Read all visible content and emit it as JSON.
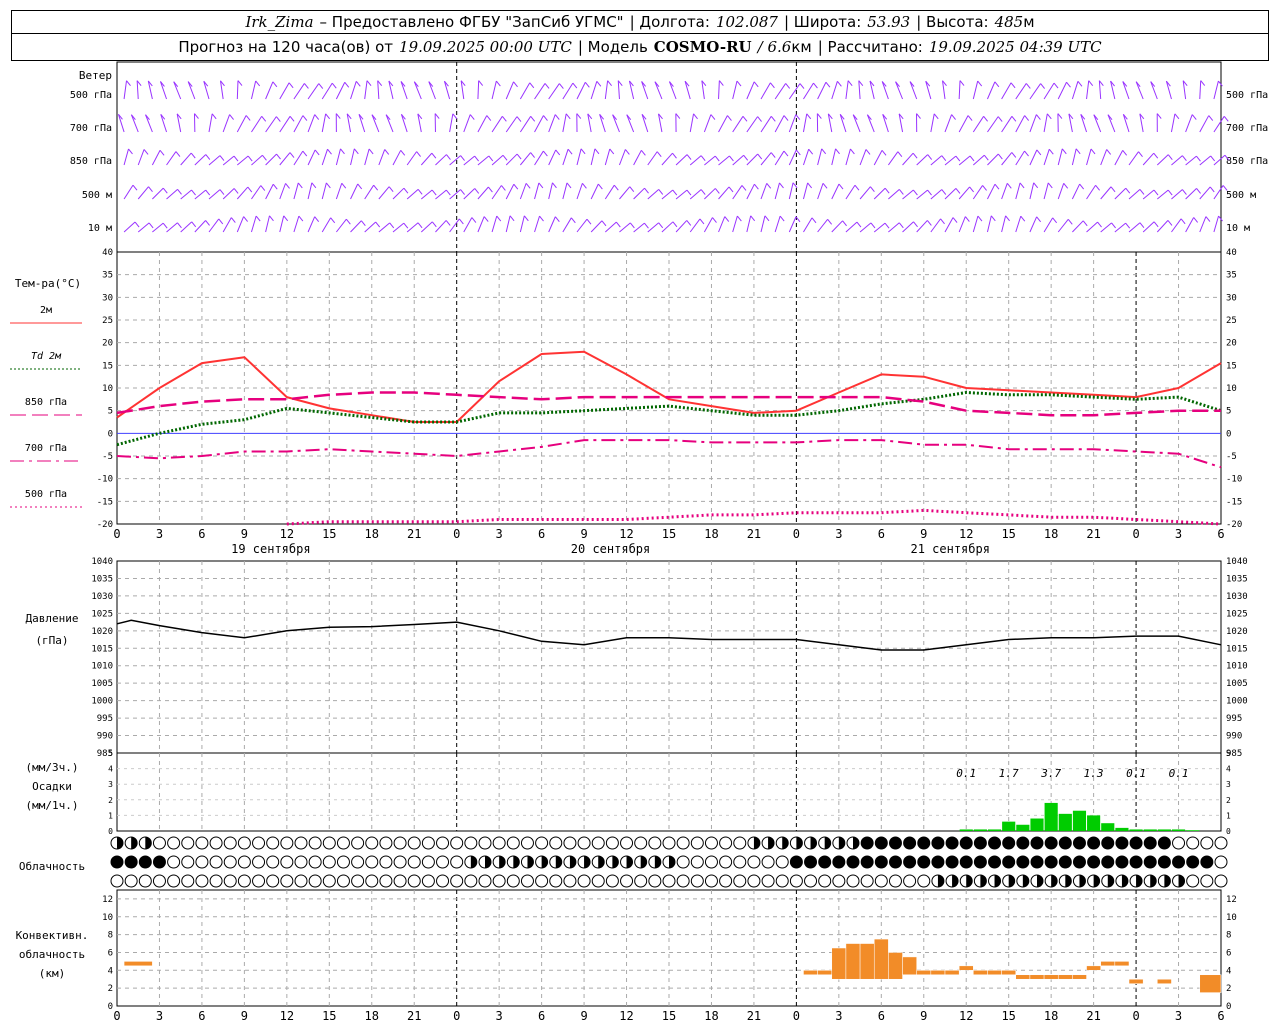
{
  "header": {
    "station": "Irk_Zima",
    "provider": "– Предоставлено ФГБУ \"ЗапСиб УГМС\"",
    "lon_label": "| Долгота:",
    "lon_value": "102.087",
    "lat_label": "| Широта:",
    "lat_value": "53.93",
    "alt_label": "| Высота:",
    "alt_value": "485",
    "alt_unit": "м",
    "forecast_prefix": "Прогноз на 120 часа(ов) от",
    "forecast_start": "19.09.2025 00:00 UTC",
    "model_label": "| Модель",
    "model_name": "COSMO-RU",
    "model_res": "/ 6.6",
    "model_res_unit": "км",
    "calc_label": "| Рассчитано:",
    "calc_time": "19.09.2025 04:39 UTC"
  },
  "wind_panel": {
    "title": "Ветер",
    "levels": [
      "500 гПа",
      "700 гПа",
      "850 гПа",
      "500 м",
      "10 м"
    ],
    "barb_color": "#9933ff"
  },
  "temp_panel": {
    "title": "Тем-ра(°C)",
    "legend": [
      {
        "label": "2м",
        "color": "#ff3333",
        "dash": "solid"
      },
      {
        "label": "Td 2м",
        "color": "#006600",
        "dash": "dotted"
      },
      {
        "label": "850 гПа",
        "color": "#e6007e",
        "dash": "long"
      },
      {
        "label": "700 гПа",
        "color": "#e6007e",
        "dash": "dashdot"
      },
      {
        "label": "500 гПа",
        "color": "#e6007e",
        "dash": "dot"
      }
    ]
  },
  "pressure_panel": {
    "title_1": "Давление",
    "title_2": "(гПа)"
  },
  "precip_panel": {
    "title_1": "(мм/3ч.)",
    "title_2": "Осадки",
    "title_3": "(мм/1ч.)",
    "labels_3h": [
      {
        "hour": 60,
        "text": "0.1"
      },
      {
        "hour": 63,
        "text": "1.7"
      },
      {
        "hour": 66,
        "text": "3.7"
      },
      {
        "hour": 69,
        "text": "1.3"
      },
      {
        "hour": 72,
        "text": "0.1"
      },
      {
        "hour": 75,
        "text": "0.1"
      }
    ]
  },
  "cloud_panel": {
    "title": "Облачность"
  },
  "conv_panel": {
    "title_1": "Конвективн.",
    "title_2": "облачность",
    "title_3": "(км)"
  },
  "time_axis": {
    "tick_labels": [
      "0",
      "3",
      "6",
      "9",
      "12",
      "15",
      "18",
      "21",
      "0",
      "3",
      "6",
      "9",
      "12",
      "15",
      "18",
      "21",
      "0",
      "3",
      "6",
      "9",
      "12",
      "15",
      "18",
      "21",
      "0",
      "3",
      "6"
    ],
    "dates": [
      {
        "hour": 12,
        "text": "19 сентября"
      },
      {
        "hour": 36,
        "text": "20 сентября"
      },
      {
        "hour": 60,
        "text": "21 сентября"
      }
    ]
  },
  "chart_data": [
    {
      "type": "line",
      "title": "Тем-ра(°C)",
      "xlabel": "UTC",
      "ylim": [
        -20,
        40
      ],
      "x_hours": [
        0,
        3,
        6,
        9,
        12,
        15,
        18,
        21,
        24,
        27,
        30,
        33,
        36,
        39,
        42,
        45,
        48,
        51,
        54,
        57,
        60,
        63,
        66,
        69,
        72,
        75,
        78
      ],
      "series": [
        {
          "name": "2м",
          "values": [
            3.5,
            10,
            15.5,
            16.8,
            8,
            5.5,
            4,
            2.5,
            2.5,
            11.5,
            17.5,
            18,
            13,
            7.5,
            6,
            4.5,
            5,
            9,
            13,
            12.5,
            10,
            9.5,
            9,
            8.5,
            8,
            10,
            15.5
          ]
        },
        {
          "name": "Td 2м",
          "values": [
            -2.5,
            0,
            2,
            3,
            5.5,
            4.5,
            3.5,
            2.5,
            2.5,
            4.5,
            4.5,
            5,
            5.5,
            6,
            5,
            4,
            4,
            5,
            6.5,
            7.5,
            9,
            8.5,
            8.5,
            8,
            7.5,
            8,
            5
          ]
        },
        {
          "name": "850 гПа",
          "values": [
            4.5,
            6,
            7,
            7.5,
            7.5,
            8.5,
            9,
            9,
            8.5,
            8,
            7.5,
            8,
            8,
            8,
            8,
            8,
            8,
            8,
            8,
            7,
            5,
            4.5,
            4,
            4,
            4.5,
            5,
            5
          ]
        },
        {
          "name": "700 гПа",
          "values": [
            -5,
            -5.5,
            -5,
            -4,
            -4,
            -3.5,
            -4,
            -4.5,
            -5,
            -4,
            -3,
            -1.5,
            -1.5,
            -1.5,
            -2,
            -2,
            -2,
            -1.5,
            -1.5,
            -2.5,
            -2.5,
            -3.5,
            -3.5,
            -3.5,
            -4,
            -4.5,
            -7.5
          ]
        },
        {
          "name": "500 гПа",
          "values": [
            null,
            null,
            null,
            null,
            -20,
            -19.5,
            -19.5,
            -19.5,
            -19.5,
            -19,
            -19,
            -19,
            -19,
            -18.5,
            -18,
            -18,
            -17.5,
            -17.5,
            -17.5,
            -17,
            -17.5,
            -18,
            -18.5,
            -18.5,
            -19,
            -19.5,
            -20
          ]
        }
      ]
    },
    {
      "type": "line",
      "title": "Давление (гПа)",
      "ylim": [
        985,
        1040
      ],
      "x_hours": [
        0,
        1,
        3,
        6,
        9,
        12,
        15,
        18,
        21,
        24,
        27,
        30,
        33,
        36,
        39,
        42,
        45,
        48,
        51,
        54,
        57,
        60,
        63,
        66,
        69,
        72,
        75,
        78
      ],
      "series": [
        {
          "name": "Давление",
          "values": [
            1022,
            1023,
            1021.5,
            1019.5,
            1018,
            1020,
            1021,
            1021.2,
            1021.8,
            1022.5,
            1020,
            1017,
            1016,
            1018,
            1018,
            1017.5,
            1017.5,
            1017.5,
            1016,
            1014.5,
            1014.5,
            1016,
            1017.5,
            1018,
            1018,
            1018.5,
            1018.5,
            1016
          ]
        }
      ]
    },
    {
      "type": "bar",
      "title": "Осадки (мм/1ч.)",
      "ylim": [
        0,
        5
      ],
      "x_hours": [
        60,
        61,
        62,
        63,
        64,
        65,
        66,
        67,
        68,
        69,
        70,
        71,
        72,
        73,
        74,
        75,
        76
      ],
      "values": [
        0.1,
        0.1,
        0.1,
        0.6,
        0.4,
        0.8,
        1.8,
        1.1,
        1.3,
        1.0,
        0.5,
        0.2,
        0.1,
        0.1,
        0.1,
        0.1,
        0.05
      ]
    },
    {
      "type": "bar",
      "title": "Конвективн. облачность (км)",
      "ylim": [
        0,
        13
      ],
      "bars": [
        {
          "x0": 0.5,
          "x1": 2.5,
          "lo": 4.5,
          "hi": 5
        },
        {
          "x0": 48.5,
          "x1": 49.5,
          "lo": 3.5,
          "hi": 4
        },
        {
          "x0": 49.5,
          "x1": 50.5,
          "lo": 3.5,
          "hi": 4
        },
        {
          "x0": 50.5,
          "x1": 51.5,
          "lo": 3,
          "hi": 6.5
        },
        {
          "x0": 51.5,
          "x1": 52.5,
          "lo": 3,
          "hi": 7
        },
        {
          "x0": 52.5,
          "x1": 53.5,
          "lo": 3,
          "hi": 7
        },
        {
          "x0": 53.5,
          "x1": 54.5,
          "lo": 3,
          "hi": 7.5
        },
        {
          "x0": 54.5,
          "x1": 55.5,
          "lo": 3,
          "hi": 6
        },
        {
          "x0": 55.5,
          "x1": 56.5,
          "lo": 3.5,
          "hi": 5.5
        },
        {
          "x0": 56.5,
          "x1": 57.5,
          "lo": 3.5,
          "hi": 4
        },
        {
          "x0": 57.5,
          "x1": 58.5,
          "lo": 3.5,
          "hi": 4
        },
        {
          "x0": 58.5,
          "x1": 59.5,
          "lo": 3.5,
          "hi": 4
        },
        {
          "x0": 59.5,
          "x1": 60.5,
          "lo": 4,
          "hi": 4.5
        },
        {
          "x0": 60.5,
          "x1": 61.5,
          "lo": 3.5,
          "hi": 4
        },
        {
          "x0": 61.5,
          "x1": 62.5,
          "lo": 3.5,
          "hi": 4
        },
        {
          "x0": 62.5,
          "x1": 63.5,
          "lo": 3.5,
          "hi": 4
        },
        {
          "x0": 63.5,
          "x1": 64.5,
          "lo": 3,
          "hi": 3.5
        },
        {
          "x0": 64.5,
          "x1": 65.5,
          "lo": 3,
          "hi": 3.5
        },
        {
          "x0": 65.5,
          "x1": 66.5,
          "lo": 3,
          "hi": 3.5
        },
        {
          "x0": 66.5,
          "x1": 67.5,
          "lo": 3,
          "hi": 3.5
        },
        {
          "x0": 67.5,
          "x1": 68.5,
          "lo": 3,
          "hi": 3.5
        },
        {
          "x0": 68.5,
          "x1": 69.5,
          "lo": 4,
          "hi": 4.5
        },
        {
          "x0": 69.5,
          "x1": 70.5,
          "lo": 4.5,
          "hi": 5
        },
        {
          "x0": 70.5,
          "x1": 71.5,
          "lo": 4.5,
          "hi": 5
        },
        {
          "x0": 71.5,
          "x1": 72.5,
          "lo": 2.5,
          "hi": 3
        },
        {
          "x0": 73.5,
          "x1": 74.5,
          "lo": 2.5,
          "hi": 3
        },
        {
          "x0": 76.5,
          "x1": 78,
          "lo": 1.5,
          "hi": 3.5
        }
      ]
    }
  ]
}
